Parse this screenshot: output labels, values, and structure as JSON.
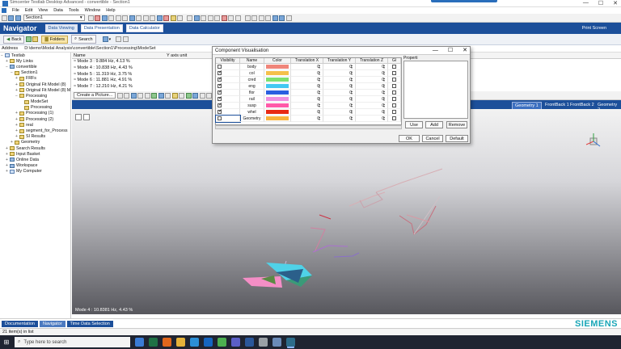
{
  "window": {
    "title": "Simcenter Testlab Desktop Advanced - convertible - Section1",
    "controls": [
      "—",
      "☐",
      "✕"
    ]
  },
  "menu": [
    "File",
    "Edit",
    "View",
    "Data",
    "Tools",
    "Window",
    "Help"
  ],
  "toolbar1": {
    "section_combo": "Section1"
  },
  "navigator": {
    "title": "Navigator",
    "tabs": [
      "Data Viewing",
      "Data Presentation",
      "Data Calculator"
    ],
    "active_tab": 0,
    "print_screen": "Print Screen"
  },
  "toolbar2": {
    "back": "Back",
    "folders": "Folders",
    "search": "Search"
  },
  "address": {
    "label": "Address",
    "path": "D:\\demo\\Modal Analysis\\convertible\\Section1\\Processing\\ModeSet"
  },
  "tree": [
    {
      "label": "Testlab",
      "indent": 0,
      "exp": "−",
      "icon": "pc"
    },
    {
      "label": "My Links",
      "indent": 1,
      "exp": "+",
      "icon": "folder"
    },
    {
      "label": "convertible",
      "indent": 1,
      "exp": "−",
      "icon": "db"
    },
    {
      "label": "Section1",
      "indent": 2,
      "exp": "−",
      "icon": "folder"
    },
    {
      "label": "FRFs",
      "indent": 3,
      "exp": "+",
      "icon": "folder"
    },
    {
      "label": "Original Fit Model (8)",
      "indent": 3,
      "exp": "+",
      "icon": "folder"
    },
    {
      "label": "Original Fit Model (8) ML",
      "indent": 3,
      "exp": "+",
      "icon": "folder"
    },
    {
      "label": "Processing",
      "indent": 3,
      "exp": "−",
      "icon": "folder"
    },
    {
      "label": "ModeSet",
      "indent": 4,
      "exp": "",
      "icon": "folder"
    },
    {
      "label": "Processing",
      "indent": 4,
      "exp": "",
      "icon": "folder"
    },
    {
      "label": "Processing (1)",
      "indent": 3,
      "exp": "+",
      "icon": "folder"
    },
    {
      "label": "Processing (2)",
      "indent": 3,
      "exp": "+",
      "icon": "folder"
    },
    {
      "label": "real",
      "indent": 3,
      "exp": "+",
      "icon": "folder"
    },
    {
      "label": "segment_for_Process",
      "indent": 3,
      "exp": "+",
      "icon": "folder"
    },
    {
      "label": "SI Results",
      "indent": 3,
      "exp": "+",
      "icon": "folder"
    },
    {
      "label": "Geometry",
      "indent": 2,
      "exp": "+",
      "icon": "folder"
    },
    {
      "label": "Search Results",
      "indent": 1,
      "exp": "+",
      "icon": "folder"
    },
    {
      "label": "Input Basket",
      "indent": 1,
      "exp": "+",
      "icon": "folder"
    },
    {
      "label": "Online Data",
      "indent": 1,
      "exp": "+",
      "icon": "db"
    },
    {
      "label": "Workspace",
      "indent": 1,
      "exp": "+",
      "icon": "db"
    },
    {
      "label": "My Computer",
      "indent": 1,
      "exp": "+",
      "icon": "pc"
    }
  ],
  "list": {
    "columns": [
      "Name",
      "Y axis unit"
    ],
    "rows": [
      "Mode 3 : 9.884 Hz, 4.13 %",
      "Mode 4 : 10.838 Hz, 4.43 %",
      "Mode 5 : 11.319 Hz, 3.75 %",
      "Mode 6 : 11.881 Hz, 4.91 %",
      "Mode 7 : 12.210 Hz, 4.21 %"
    ]
  },
  "display": {
    "create_picture": "Create a Picture...",
    "tabs": [
      "Geometry 1",
      "FrontBack 1",
      "FrontBack 2",
      "Geometry 2"
    ],
    "active_tab": 0,
    "mode_label": "Mode 4 : 10.8381 Hz, 4.43 %"
  },
  "dialog": {
    "title": "Component Visualisation",
    "headers": [
      "Visibility",
      "Name",
      "Color",
      "Translation X",
      "Translation Y",
      "Translation Z",
      "Gl"
    ],
    "rows": [
      {
        "visible": false,
        "name": "body",
        "color": "#f0857a",
        "tx": "0",
        "ty": "0",
        "tz": "0"
      },
      {
        "visible": true,
        "name": "col",
        "color": "#f5c04a",
        "tx": "0",
        "ty": "0",
        "tz": "0"
      },
      {
        "visible": true,
        "name": "cred",
        "color": "#7fe06f",
        "tx": "0",
        "ty": "0",
        "tz": "0"
      },
      {
        "visible": true,
        "name": "eng",
        "color": "#42c8f2",
        "tx": "0",
        "ty": "0",
        "tz": "0"
      },
      {
        "visible": true,
        "name": "flor",
        "color": "#2a5fe0",
        "tx": "0",
        "ty": "0",
        "tz": "0"
      },
      {
        "visible": true,
        "name": "rail",
        "color": "#ee8fe0",
        "tx": "0",
        "ty": "0",
        "tz": "0"
      },
      {
        "visible": true,
        "name": "susp",
        "color": "#ff5aa8",
        "tx": "0",
        "ty": "0",
        "tz": "0"
      },
      {
        "visible": true,
        "name": "whel",
        "color": "#e82a14",
        "tx": "0",
        "ty": "0",
        "tz": "0"
      },
      {
        "visible": false,
        "name": "Geometry",
        "color": "#f7b33c",
        "tx": "0",
        "ty": "0",
        "tz": "0"
      }
    ],
    "properties_label": "Properti",
    "buttons": {
      "use": "Use",
      "add": "Add",
      "remove": "Remove",
      "ok": "OK",
      "cancel": "Cancel",
      "default": "Default"
    }
  },
  "bottom_tabs": [
    "Documentation",
    "Navigator",
    "Time Data Selection"
  ],
  "brand": "SIEMENS",
  "status": "21 item(s) in list",
  "taskbar": {
    "search_placeholder": "Type here to search",
    "apps": [
      {
        "name": "start-icon",
        "color": "#3a7bd5"
      },
      {
        "name": "excel-icon",
        "color": "#1e7145"
      },
      {
        "name": "firefox-icon",
        "color": "#e0661b"
      },
      {
        "name": "explorer-icon",
        "color": "#e5b23a"
      },
      {
        "name": "edge-icon",
        "color": "#2b8fd6"
      },
      {
        "name": "outlook-icon",
        "color": "#1565c0"
      },
      {
        "name": "chrome-icon",
        "color": "#4caf50"
      },
      {
        "name": "teams-icon",
        "color": "#5b5fc7"
      },
      {
        "name": "word-icon",
        "color": "#2b579a"
      },
      {
        "name": "snip-icon",
        "color": "#9aa0a6"
      },
      {
        "name": "app-icon",
        "color": "#6b8bb8"
      },
      {
        "name": "testlab-icon",
        "color": "#2d6c8a"
      }
    ]
  }
}
